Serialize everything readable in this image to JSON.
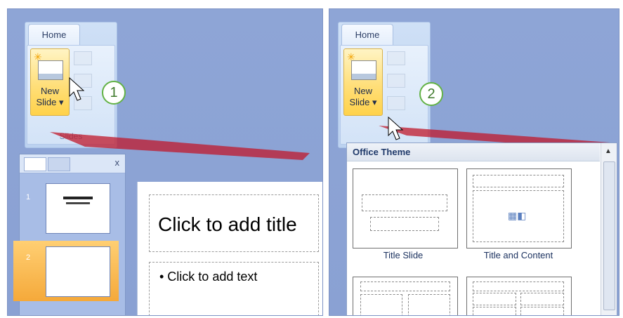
{
  "left": {
    "ribbon": {
      "tab_label": "Home",
      "new_label": "New",
      "slide_label": "Slide",
      "group_label": "Slides"
    },
    "badge": "1",
    "thumbnail_pane": {
      "close_glyph": "x",
      "slides": [
        "1",
        "2"
      ]
    },
    "slide": {
      "title_placeholder": "Click to add title",
      "body_placeholder": "• Click to add text"
    }
  },
  "right": {
    "ribbon": {
      "tab_label": "Home",
      "new_label": "New",
      "slide_label": "Slide"
    },
    "badge": "2",
    "gallery": {
      "header": "Office Theme",
      "layouts": [
        "Title Slide",
        "Title and Content"
      ]
    }
  },
  "colors": {
    "panel": "#8ea5d6",
    "callout": "#c0182b",
    "badge_border": "#63b246",
    "selected_thumb": "#f5a93a"
  }
}
